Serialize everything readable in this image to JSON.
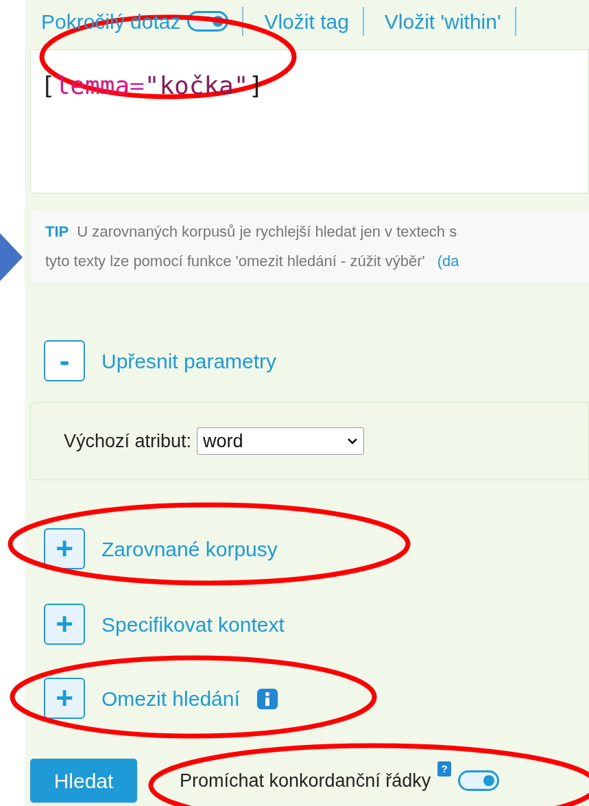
{
  "toolbar": {
    "advanced_query": {
      "label": "Pokročilý dotaz",
      "on": true
    },
    "links": [
      "Vložit tag",
      "Vložit 'within'"
    ]
  },
  "query": {
    "tokens": [
      {
        "kind": "bracket",
        "text": "["
      },
      {
        "kind": "attr",
        "text": "lemma"
      },
      {
        "kind": "op",
        "text": "="
      },
      {
        "kind": "string",
        "text": "\"kočka\""
      },
      {
        "kind": "bracket",
        "text": "]"
      }
    ]
  },
  "tip": {
    "label": "TIP",
    "line_1": "U zarovnaných korpusů je rychlejší hledat jen v textech s",
    "line_2": "tyto texty lze pomocí funkce 'omezit hledání - zúžit výběr'",
    "link": "(da"
  },
  "sections": [
    {
      "label": "Upřesnit parametry",
      "expanded": true,
      "toggle": "-",
      "info": false
    },
    {
      "label": "Zarovnané korpusy",
      "expanded": false,
      "toggle": "+",
      "info": false
    },
    {
      "label": "Specifikovat kontext",
      "expanded": false,
      "toggle": "+",
      "info": false
    },
    {
      "label": "Omezit hledání",
      "expanded": false,
      "toggle": "+",
      "info": true
    }
  ],
  "parameters": {
    "default_attribute_label": "Výchozí atribut:",
    "default_attribute_value": "word"
  },
  "search_button": "Hledat",
  "shuffle": {
    "label": "Promíchat konkordanční řádky",
    "help": "?",
    "on": true
  }
}
